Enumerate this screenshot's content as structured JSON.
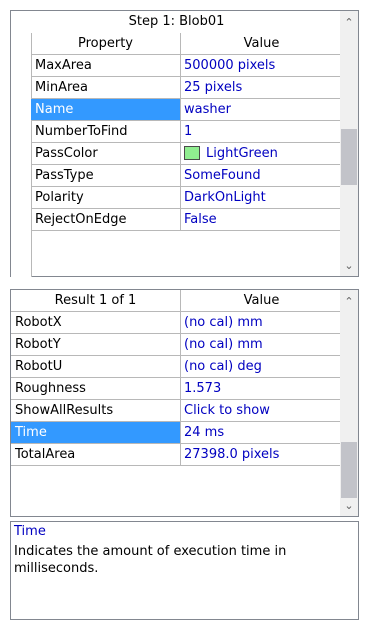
{
  "properties_panel": {
    "title": "Step 1: Blob01",
    "header": {
      "property": "Property",
      "value": "Value"
    },
    "rows": [
      {
        "name": "MaxArea",
        "value": "500000 pixels"
      },
      {
        "name": "MinArea",
        "value": "25 pixels"
      },
      {
        "name": "Name",
        "value": "washer"
      },
      {
        "name": "NumberToFind",
        "value": "1"
      },
      {
        "name": "PassColor",
        "value": "LightGreen",
        "swatch": "#90ee90"
      },
      {
        "name": "PassType",
        "value": "SomeFound"
      },
      {
        "name": "Polarity",
        "value": "DarkOnLight"
      },
      {
        "name": "RejectOnEdge",
        "value": "False"
      }
    ],
    "selected_row": "Name"
  },
  "results_panel": {
    "header": {
      "result": "Result 1 of 1",
      "value": "Value"
    },
    "rows": [
      {
        "name": "RobotX",
        "value": "(no cal) mm"
      },
      {
        "name": "RobotY",
        "value": "(no cal) mm"
      },
      {
        "name": "RobotU",
        "value": "(no cal) deg"
      },
      {
        "name": "Roughness",
        "value": "1.573"
      },
      {
        "name": "ShowAllResults",
        "value": "Click to show"
      },
      {
        "name": "Time",
        "value": "24 ms"
      },
      {
        "name": "TotalArea",
        "value": "27398.0 pixels"
      }
    ],
    "selected_row": "Time"
  },
  "description": {
    "title": "Time",
    "text": "Indicates the amount of execution time in milliseconds."
  },
  "colors": {
    "selection": "#3399ff",
    "value_text": "#0000c0",
    "grid_line": "#b8b8b8"
  }
}
